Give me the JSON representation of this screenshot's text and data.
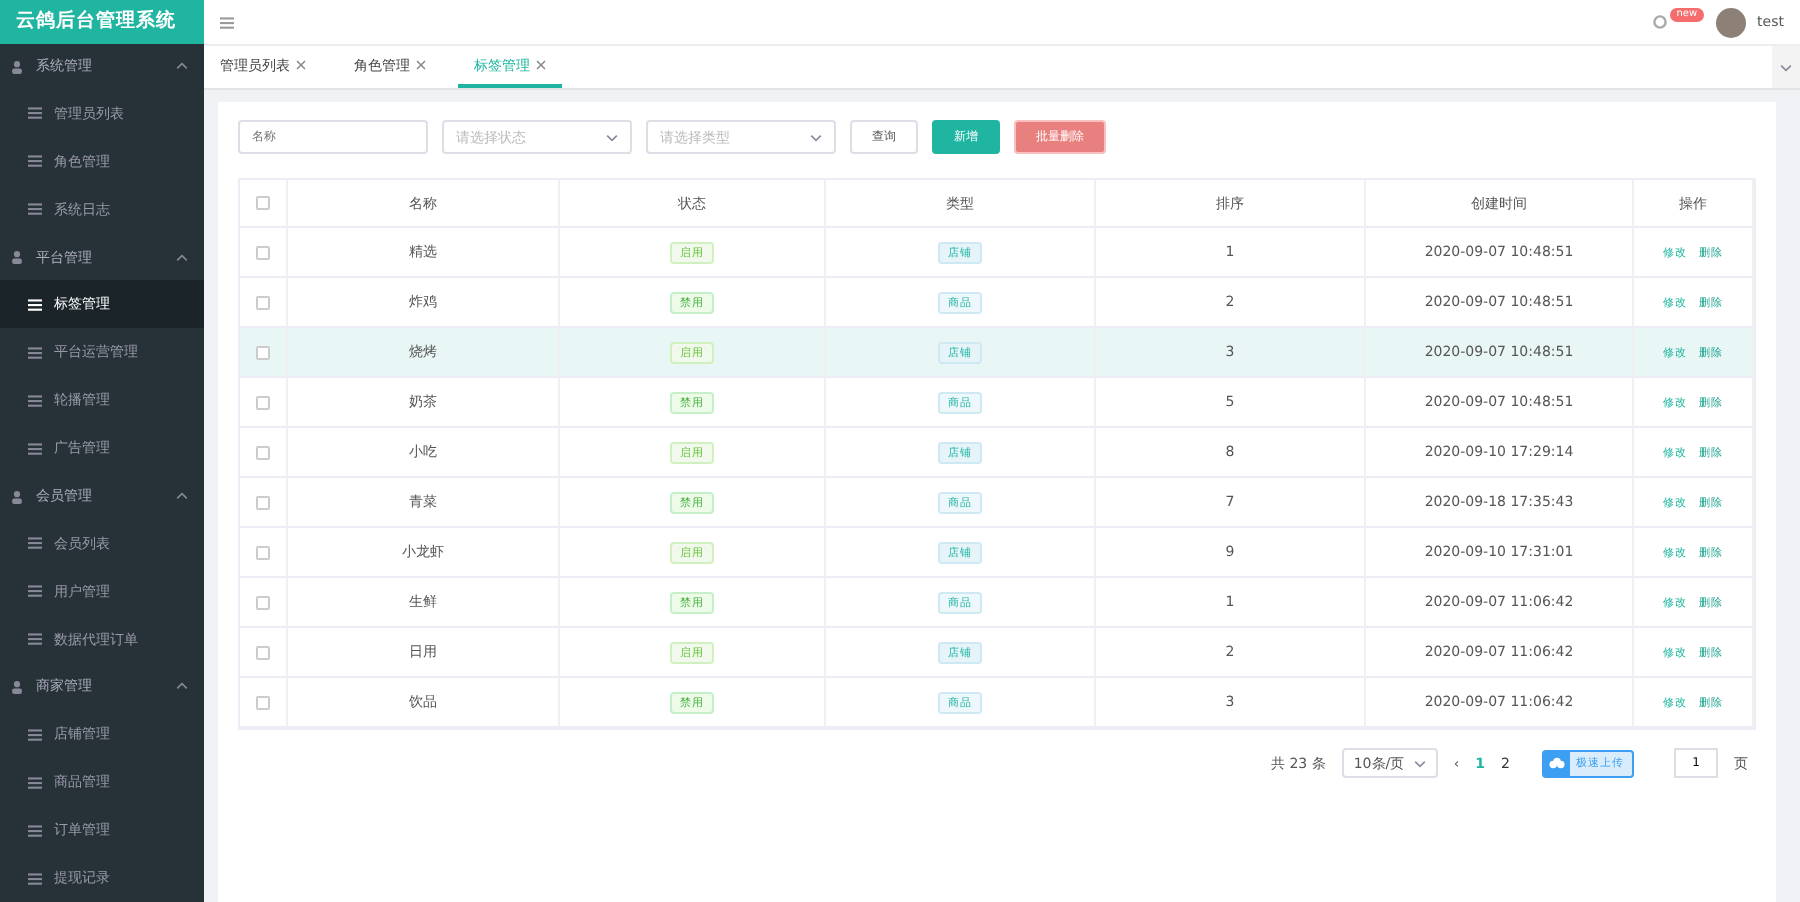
{
  "brand": "云鸽后台管理系统",
  "header": {
    "badge": "new",
    "user": "test"
  },
  "sidebar": [
    {
      "label": "系统管理",
      "expanded": true,
      "children": [
        {
          "label": "管理员列表",
          "selected": false
        },
        {
          "label": "角色管理",
          "selected": false
        },
        {
          "label": "系统日志",
          "selected": false
        }
      ]
    },
    {
      "label": "平台管理",
      "expanded": true,
      "children": [
        {
          "label": "标签管理",
          "selected": true
        },
        {
          "label": "平台运营管理",
          "selected": false
        },
        {
          "label": "轮播管理",
          "selected": false
        },
        {
          "label": "广告管理",
          "selected": false
        }
      ]
    },
    {
      "label": "会员管理",
      "expanded": true,
      "children": [
        {
          "label": "会员列表",
          "selected": false
        },
        {
          "label": "用户管理",
          "selected": false
        },
        {
          "label": "数据代理订单",
          "selected": false
        }
      ]
    },
    {
      "label": "商家管理",
      "expanded": true,
      "children": [
        {
          "label": "店铺管理",
          "selected": false
        },
        {
          "label": "商品管理",
          "selected": false
        },
        {
          "label": "订单管理",
          "selected": false
        },
        {
          "label": "提现记录",
          "selected": false
        }
      ]
    }
  ],
  "tabs": [
    {
      "label": "管理员列表",
      "selected": false
    },
    {
      "label": "角色管理",
      "selected": false
    },
    {
      "label": "标签管理",
      "selected": true
    }
  ],
  "filters": {
    "name_placeholder": "名称",
    "status_placeholder": "请选择状态",
    "type_placeholder": "请选择类型",
    "query": "查询",
    "add": "新增",
    "batch_delete": "批量删除"
  },
  "table": {
    "columns": [
      "名称",
      "状态",
      "类型",
      "排序",
      "创建时间",
      "操作"
    ],
    "rows": [
      {
        "name": "精选",
        "status": "启用",
        "enabled": true,
        "type": "店铺",
        "sort": "1",
        "time": "2020-09-07 10:48:51",
        "highlighted": false,
        "checked": false,
        "actions": [
          "修改",
          "删除"
        ]
      },
      {
        "name": "炸鸡",
        "status": "禁用",
        "enabled": false,
        "type": "商品",
        "sort": "2",
        "time": "2020-09-07 10:48:51",
        "highlighted": false,
        "checked": false,
        "actions": [
          "修改",
          "删除"
        ]
      },
      {
        "name": "烧烤",
        "status": "启用",
        "enabled": true,
        "type": "店铺",
        "sort": "3",
        "time": "2020-09-07 10:48:51",
        "highlighted": true,
        "checked": false,
        "actions": [
          "修改",
          "删除"
        ]
      },
      {
        "name": "奶茶",
        "status": "禁用",
        "enabled": false,
        "type": "商品",
        "sort": "5",
        "time": "2020-09-07 10:48:51",
        "highlighted": false,
        "checked": false,
        "actions": [
          "修改",
          "删除"
        ]
      },
      {
        "name": "小吃",
        "status": "启用",
        "enabled": true,
        "type": "店铺",
        "sort": "8",
        "time": "2020-09-10 17:29:14",
        "highlighted": false,
        "checked": false,
        "actions": [
          "修改",
          "删除"
        ]
      },
      {
        "name": "青菜",
        "status": "禁用",
        "enabled": false,
        "type": "商品",
        "sort": "7",
        "time": "2020-09-18 17:35:43",
        "highlighted": false,
        "checked": false,
        "actions": [
          "修改",
          "删除"
        ]
      },
      {
        "name": "小龙虾",
        "status": "启用",
        "enabled": true,
        "type": "店铺",
        "sort": "9",
        "time": "2020-09-10 17:31:01",
        "highlighted": false,
        "checked": false,
        "actions": [
          "修改",
          "删除"
        ]
      },
      {
        "name": "生鲜",
        "status": "禁用",
        "enabled": false,
        "type": "商品",
        "sort": "1",
        "time": "2020-09-07 11:06:42",
        "highlighted": false,
        "checked": false,
        "actions": [
          "修改",
          "删除"
        ]
      },
      {
        "name": "日用",
        "status": "启用",
        "enabled": true,
        "type": "店铺",
        "sort": "2",
        "time": "2020-09-07 11:06:42",
        "highlighted": false,
        "checked": false,
        "actions": [
          "修改",
          "删除"
        ]
      },
      {
        "name": "饮品",
        "status": "禁用",
        "enabled": false,
        "type": "商品",
        "sort": "3",
        "time": "2020-09-07 11:06:42",
        "highlighted": false,
        "checked": false,
        "actions": [
          "修改",
          "删除"
        ]
      }
    ],
    "all_checked": false
  },
  "pagination": {
    "total": "共 23 条",
    "page_size": "10条/页",
    "prev": "‹",
    "pages": [
      {
        "label": "1",
        "selected": true
      },
      {
        "label": "2",
        "selected": false
      }
    ],
    "jump_value": "1",
    "page_unit": "页"
  },
  "upload_widget": {
    "label": "极速上传"
  }
}
